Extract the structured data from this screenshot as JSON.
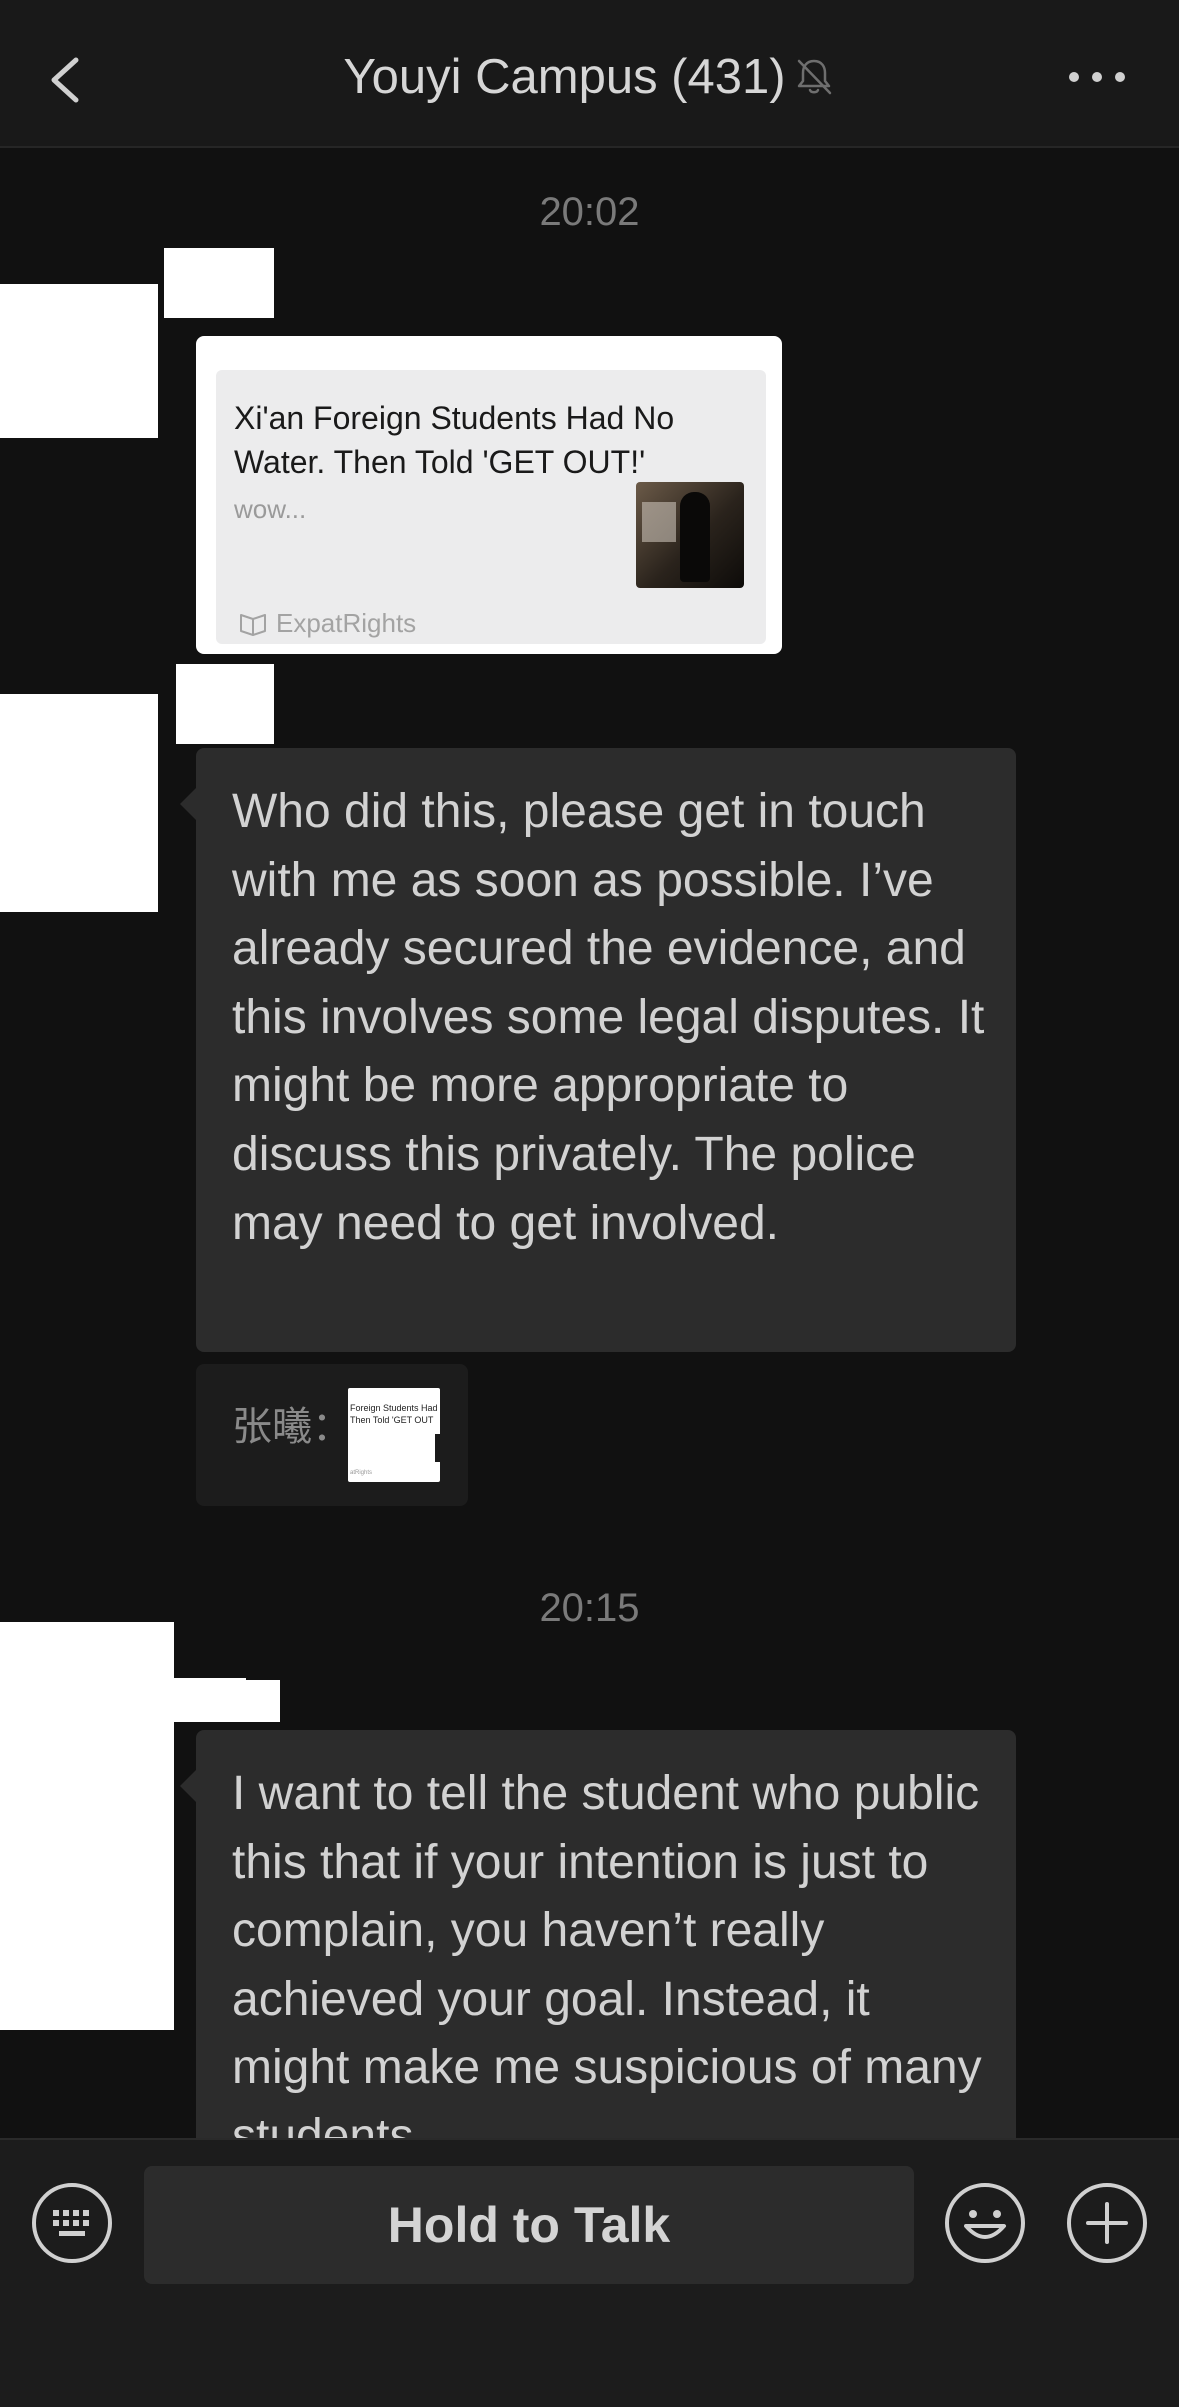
{
  "header": {
    "title": "Youyi Campus (431)",
    "back_icon": "chevron-left-icon",
    "mute_icon": "bell-muted-icon",
    "more_icon": "more-dots-icon"
  },
  "chat": {
    "timestamps": [
      "20:02",
      "20:15"
    ],
    "link_card": {
      "title": "Xi'an Foreign Students Had No Water. Then Told 'GET OUT!'",
      "description": "wow...",
      "source": "ExpatRights"
    },
    "message_1": "Who did this, please get in touch with me as soon as possible. I’ve already secured the evidence, and this involves some legal disputes. It might be more appropriate to discuss this privately. The police may need to get involved.",
    "quote": {
      "name": "张曦：",
      "thumb_title": "Foreign Students Had\nThen Told 'GET OUT",
      "thumb_source": "atRights"
    },
    "message_2": "I want to tell the student who public this that if your intention is just to complain, you haven’t really achieved your goal. Instead, it might make me suspicious of many students"
  },
  "input_bar": {
    "hold_to_talk_label": "Hold to Talk",
    "keyboard_icon": "keyboard-icon",
    "emoji_icon": "emoji-icon",
    "plus_icon": "plus-icon"
  },
  "colors": {
    "background": "#111111",
    "header": "#191919",
    "bubble": "#2c2c2c",
    "text": "#d2d2d2"
  }
}
